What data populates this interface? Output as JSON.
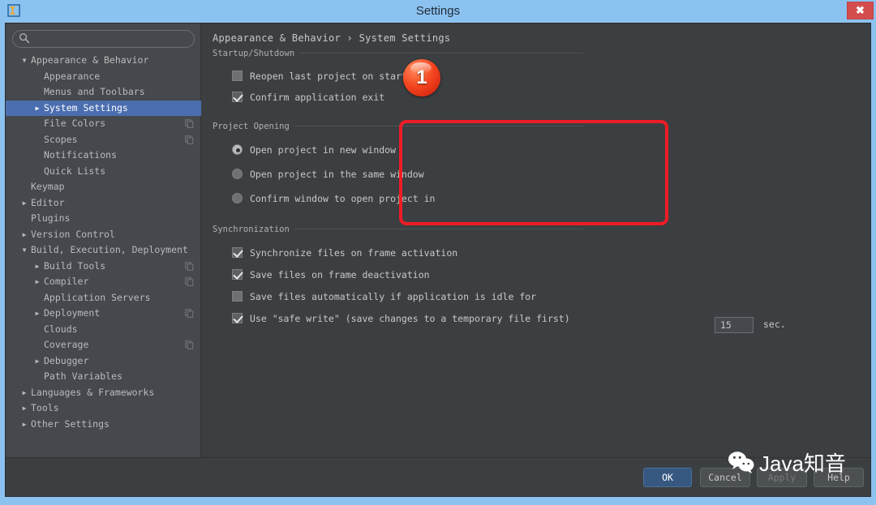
{
  "window": {
    "title": "Settings",
    "app_icon": "intellij-idea-icon",
    "close_label": "✖"
  },
  "sidebar": {
    "search": {
      "value": "",
      "placeholder": "",
      "icon": "search-icon"
    },
    "items": [
      {
        "label": "Appearance & Behavior",
        "level": 0,
        "arrow": "▼",
        "selected": false,
        "copy": false
      },
      {
        "label": "Appearance",
        "level": 1,
        "arrow": "",
        "selected": false,
        "copy": false
      },
      {
        "label": "Menus and Toolbars",
        "level": 1,
        "arrow": "",
        "selected": false,
        "copy": false
      },
      {
        "label": "System Settings",
        "level": 1,
        "arrow": "▶",
        "selected": true,
        "copy": false
      },
      {
        "label": "File Colors",
        "level": 1,
        "arrow": "",
        "selected": false,
        "copy": true
      },
      {
        "label": "Scopes",
        "level": 1,
        "arrow": "",
        "selected": false,
        "copy": true
      },
      {
        "label": "Notifications",
        "level": 1,
        "arrow": "",
        "selected": false,
        "copy": false
      },
      {
        "label": "Quick Lists",
        "level": 1,
        "arrow": "",
        "selected": false,
        "copy": false
      },
      {
        "label": "Keymap",
        "level": 0,
        "arrow": "",
        "selected": false,
        "copy": false
      },
      {
        "label": "Editor",
        "level": 0,
        "arrow": "▶",
        "selected": false,
        "copy": false
      },
      {
        "label": "Plugins",
        "level": 0,
        "arrow": "",
        "selected": false,
        "copy": false
      },
      {
        "label": "Version Control",
        "level": 0,
        "arrow": "▶",
        "selected": false,
        "copy": false
      },
      {
        "label": "Build, Execution, Deployment",
        "level": 0,
        "arrow": "▼",
        "selected": false,
        "copy": false
      },
      {
        "label": "Build Tools",
        "level": 1,
        "arrow": "▶",
        "selected": false,
        "copy": true
      },
      {
        "label": "Compiler",
        "level": 1,
        "arrow": "▶",
        "selected": false,
        "copy": true
      },
      {
        "label": "Application Servers",
        "level": 1,
        "arrow": "",
        "selected": false,
        "copy": false
      },
      {
        "label": "Deployment",
        "level": 1,
        "arrow": "▶",
        "selected": false,
        "copy": true
      },
      {
        "label": "Clouds",
        "level": 1,
        "arrow": "",
        "selected": false,
        "copy": false
      },
      {
        "label": "Coverage",
        "level": 1,
        "arrow": "",
        "selected": false,
        "copy": true
      },
      {
        "label": "Debugger",
        "level": 1,
        "arrow": "▶",
        "selected": false,
        "copy": false
      },
      {
        "label": "Path Variables",
        "level": 1,
        "arrow": "",
        "selected": false,
        "copy": false
      },
      {
        "label": "Languages & Frameworks",
        "level": 0,
        "arrow": "▶",
        "selected": false,
        "copy": false
      },
      {
        "label": "Tools",
        "level": 0,
        "arrow": "▶",
        "selected": false,
        "copy": false
      },
      {
        "label": "Other Settings",
        "level": 0,
        "arrow": "▶",
        "selected": false,
        "copy": false
      }
    ]
  },
  "content": {
    "breadcrumb": "Appearance & Behavior › System Settings",
    "sections": {
      "startup": {
        "title": "Startup/Shutdown",
        "options": [
          {
            "label": "Reopen last project on startup",
            "checked": false
          },
          {
            "label": "Confirm application exit",
            "checked": true
          }
        ]
      },
      "project_opening": {
        "title": "Project Opening",
        "options": [
          {
            "label": "Open project in new window",
            "selected": true
          },
          {
            "label": "Open project in the same window",
            "selected": false
          },
          {
            "label": "Confirm window to open project in",
            "selected": false
          }
        ]
      },
      "synchronization": {
        "title": "Synchronization",
        "options": [
          {
            "label": "Synchronize files on frame activation",
            "checked": true
          },
          {
            "label": "Save files on frame deactivation",
            "checked": true
          },
          {
            "label": "Save files automatically if application is idle for",
            "checked": false
          },
          {
            "label": "Use \"safe write\" (save changes to a temporary file first)",
            "checked": true
          }
        ],
        "idle_value": "15",
        "idle_unit": "sec."
      }
    }
  },
  "annotations": {
    "badge_number": "1",
    "badge_color": "#f4451f",
    "highlight_color": "#ee1c25"
  },
  "buttons": {
    "ok": "OK",
    "cancel": "Cancel",
    "apply": "Apply",
    "help": "Help"
  },
  "watermark": {
    "text": "Java知音",
    "logo": "wechat-icon"
  }
}
